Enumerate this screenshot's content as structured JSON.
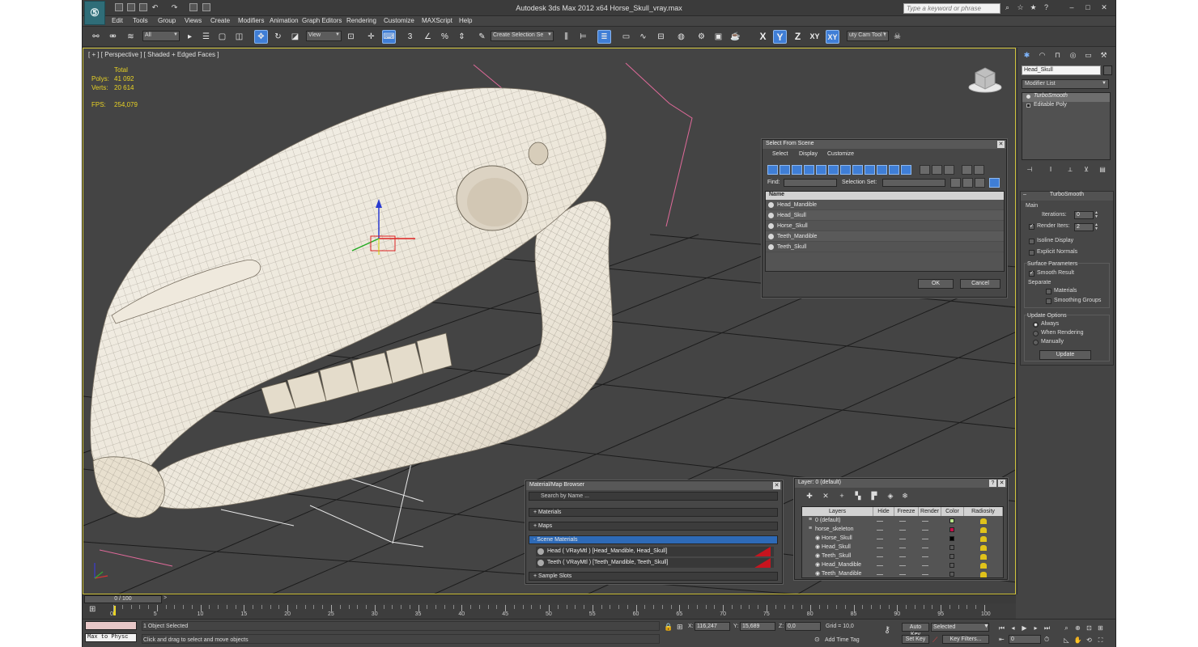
{
  "window": {
    "title": "Autodesk 3ds Max  2012 x64      Horse_Skull_vray.max",
    "search_placeholder": "Type a keyword or phrase",
    "logo": "3ds-max-logo"
  },
  "menu": [
    "Edit",
    "Tools",
    "Group",
    "Views",
    "Create",
    "Modifiers",
    "Animation",
    "Graph Editors",
    "Rendering",
    "Customize",
    "MAXScript",
    "Help"
  ],
  "toolbar": {
    "filter_value": "All",
    "ref_coord_value": "View",
    "selection_set_placeholder": "Create Selection Se",
    "snap_numbers": [
      "3",
      "",
      "%",
      ""
    ],
    "axes": [
      "X",
      "Y",
      "Z",
      "XY",
      "XY"
    ],
    "camera_tool_label": "uty Cam Tool \\"
  },
  "viewport": {
    "label": "[ + ] [ Perspective ] [ Shaded + Edged Faces ]",
    "stats": {
      "total_label": "Total",
      "polys_label": "Polys:",
      "polys_value": "41 092",
      "verts_label": "Verts:",
      "verts_value": "20 614",
      "fps_label": "FPS:",
      "fps_value": "254,079"
    },
    "viewcube_label": "top"
  },
  "command_panel": {
    "object_name": "Head_Skull",
    "modifier_list_label": "Modifier List",
    "stack": [
      "TurboSmooth",
      "Editable Poly"
    ],
    "turbosmooth": {
      "rollout_title": "TurboSmooth",
      "main_label": "Main",
      "iterations_label": "Iterations:",
      "iterations_value": "0",
      "render_iters_label": "Render Iters:",
      "render_iters_value": "2",
      "render_iters_checked": true,
      "isoline_label": "Isoline Display",
      "explicit_label": "Explicit Normals",
      "surface_label": "Surface Parameters",
      "smooth_result_label": "Smooth Result",
      "separate_label": "Separate",
      "materials_label": "Materials",
      "smoothing_label": "Smoothing Groups",
      "update_options_label": "Update Options",
      "always_label": "Always",
      "when_rendering_label": "When Rendering",
      "manually_label": "Manually",
      "update_button": "Update"
    }
  },
  "select_from_scene": {
    "title": "Select From Scene",
    "menu": [
      "Select",
      "Display",
      "Customize"
    ],
    "find_label": "Find:",
    "selection_set_label": "Selection Set:",
    "column_name": "Name",
    "items": [
      "Head_Mandible",
      "Head_Skull",
      "Horse_Skull",
      "Teeth_Mandible",
      "Teeth_Skull"
    ],
    "ok_label": "OK",
    "cancel_label": "Cancel"
  },
  "material_browser": {
    "title": "Material/Map Browser",
    "search_placeholder": "Search by Name ...",
    "groups": [
      "+ Materials",
      "+ Maps",
      "- Scene Materials",
      "+ Sample Slots"
    ],
    "scene_materials": [
      "Head  ( VRayMtl )  [Head_Mandible, Head_Skull]",
      "Teeth  ( VRayMtl )  [Teeth_Mandible, Teeth_Skull]"
    ]
  },
  "layer_dialog": {
    "title": "Layer: 0 (default)",
    "columns": [
      "Layers",
      "Hide",
      "Freeze",
      "Render",
      "Color",
      "Radiosity"
    ],
    "rows": [
      {
        "name": "0 (default)",
        "color": "#b8e58a",
        "indent": 0
      },
      {
        "name": "horse_skeleton",
        "color": "#c8104a",
        "indent": 0
      },
      {
        "name": "Horse_Skull",
        "color": "#000000",
        "indent": 1
      },
      {
        "name": "Head_Skull",
        "color": "#5a5a5a",
        "indent": 1
      },
      {
        "name": "Teeth_Skull",
        "color": "#5a5a5a",
        "indent": 1
      },
      {
        "name": "Head_Mandible",
        "color": "#5a5a5a",
        "indent": 1
      },
      {
        "name": "Teeth_Mandible",
        "color": "#5a5a5a",
        "indent": 1
      }
    ]
  },
  "timeline": {
    "frame_label": "0 / 100",
    "tick_labels": [
      "0",
      "5",
      "10",
      "15",
      "20",
      "25",
      "30",
      "35",
      "40",
      "45",
      "50",
      "55",
      "60",
      "65",
      "70",
      "75",
      "80",
      "85",
      "90",
      "95",
      "100"
    ]
  },
  "status": {
    "maxscript_label": "Max to Physc",
    "selection_status": "1 Object Selected",
    "prompt": "Click and drag to select and move objects",
    "x_label": "X:",
    "x_value": "116,247",
    "y_label": "Y:",
    "y_value": "15,689",
    "z_label": "Z:",
    "z_value": "0,0",
    "grid_label": "Grid = 10,0",
    "add_time_tag": "Add Time Tag",
    "auto_key": "Auto Key",
    "set_key": "Set Key",
    "selected_value": "Selected",
    "key_filters": "Key Filters...",
    "frame_value": "0"
  },
  "colors": {
    "viewport_bg": "#444444",
    "accent_blue": "#3f7ed6",
    "active_border": "#cfc23a",
    "stats_yellow": "#e8d224",
    "material_red": "#c8141e"
  }
}
